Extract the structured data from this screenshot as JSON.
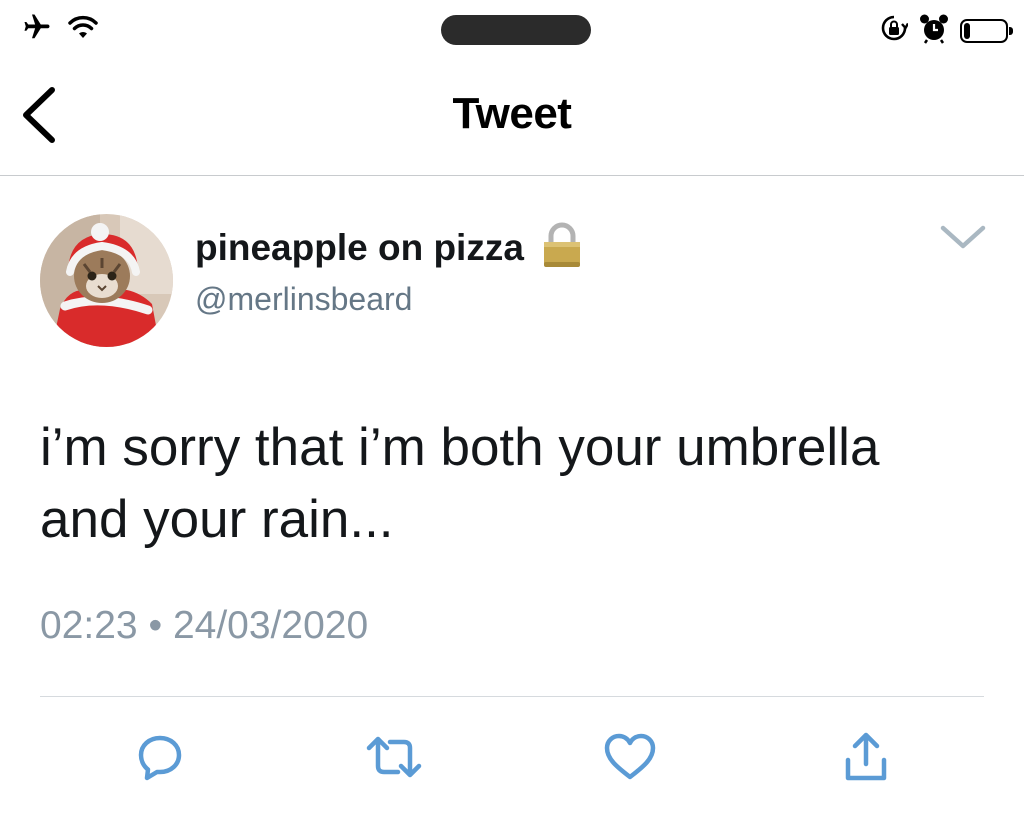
{
  "status_bar": {
    "left_icons": [
      "airplane-icon",
      "wifi-icon"
    ],
    "right_icons": [
      "orientation-lock-icon",
      "alarm-icon",
      "battery-icon"
    ],
    "battery_level": 0.15
  },
  "nav": {
    "title": "Tweet",
    "back_icon": "chevron-left-icon"
  },
  "tweet": {
    "author": {
      "display_name": "pineapple on pizza",
      "handle": "@merlinsbeard",
      "protected_icon": "lock-icon",
      "avatar": "cat-in-santa-costume"
    },
    "text": "i’m sorry that i’m both your umbrella and your rain...",
    "time": "02:23",
    "separator": "•",
    "date": "24/03/2020",
    "actions": [
      {
        "name": "reply",
        "icon": "reply-icon"
      },
      {
        "name": "retweet",
        "icon": "retweet-icon"
      },
      {
        "name": "like",
        "icon": "heart-icon"
      },
      {
        "name": "share",
        "icon": "share-icon"
      }
    ]
  },
  "colors": {
    "primary_text": "#14171a",
    "secondary_text": "#657786",
    "meta_text": "#8a98a5",
    "action_icon": "#5b9bd5",
    "divider": "#d6dade",
    "lock_gold": "#c9a94f"
  }
}
